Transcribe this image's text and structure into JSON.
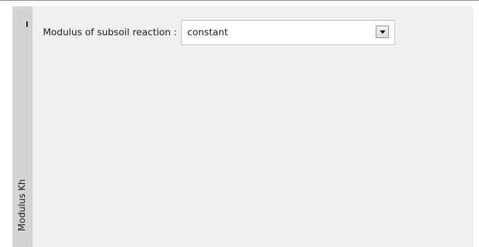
{
  "side_tab": {
    "label": "Modulus Kh"
  },
  "form": {
    "modulus_label": "Modulus of subsoil reaction :",
    "modulus_value": "constant",
    "dropdown_icon": "chevron-down-icon"
  }
}
